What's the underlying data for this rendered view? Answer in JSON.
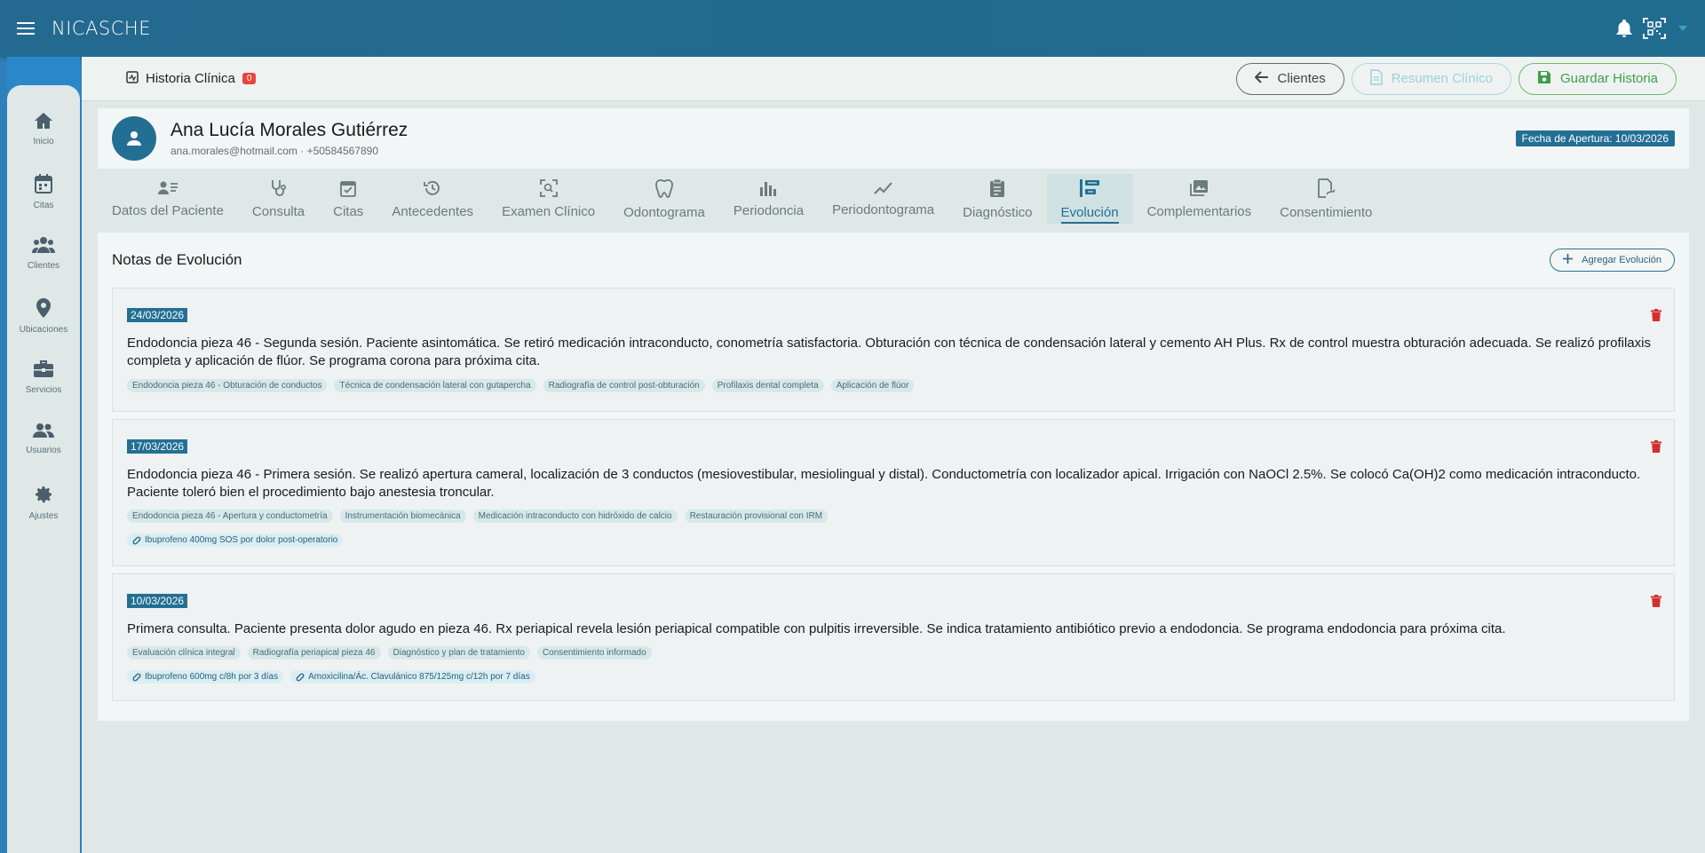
{
  "app": {
    "brand": "NICASCHE"
  },
  "sidebar": {
    "items": [
      {
        "label": "Inicio",
        "icon": "home-icon"
      },
      {
        "label": "Citas",
        "icon": "calendar-icon"
      },
      {
        "label": "Clientes",
        "icon": "people-icon"
      },
      {
        "label": "Ubicaciones",
        "icon": "location-icon"
      },
      {
        "label": "Servicios",
        "icon": "briefcase-icon"
      },
      {
        "label": "Usuarios",
        "icon": "users-icon"
      },
      {
        "label": "Ajustes",
        "icon": "gear-icon"
      }
    ]
  },
  "topbar": {
    "title": "Historia Clínica",
    "count": "0",
    "clientes_label": "Clientes",
    "resumen_label": "Resumen Clínico",
    "guardar_label": "Guardar Historia"
  },
  "patient": {
    "name": "Ana Lucía Morales Gutiérrez",
    "contact": "ana.morales@hotmail.com · +50584567890",
    "opening_date": "Fecha de Apertura: 10/03/2026"
  },
  "tabs": [
    {
      "label": "Datos del Paciente",
      "icon": "patient-list-icon"
    },
    {
      "label": "Consulta",
      "icon": "stethoscope-icon"
    },
    {
      "label": "Citas",
      "icon": "calendar-check-icon"
    },
    {
      "label": "Antecedentes",
      "icon": "history-icon"
    },
    {
      "label": "Examen Clínico",
      "icon": "scan-icon"
    },
    {
      "label": "Odontograma",
      "icon": "tooth-icon"
    },
    {
      "label": "Periodoncia",
      "icon": "bar-chart-icon"
    },
    {
      "label": "Periodontograma",
      "icon": "line-chart-icon"
    },
    {
      "label": "Diagnóstico",
      "icon": "clipboard-icon"
    },
    {
      "label": "Evolución",
      "icon": "timeline-icon",
      "active": true
    },
    {
      "label": "Complementarios",
      "icon": "images-icon"
    },
    {
      "label": "Consentimiento",
      "icon": "signature-icon"
    }
  ],
  "content": {
    "title": "Notas de Evolución",
    "add_label": "Agregar Evolución"
  },
  "notes": [
    {
      "date": "24/03/2026",
      "text": "Endodoncia pieza 46 - Segunda sesión. Paciente asintomática. Se retiró medicación intraconducto, conometría satisfactoria. Obturación con técnica de condensación lateral y cemento AH Plus. Rx de control muestra obturación adecuada. Se realizó profilaxis completa y aplicación de flúor. Se programa corona para próxima cita.",
      "tags": [
        "Endodoncia pieza 46 - Obturación de conductos",
        "Técnica de condensación lateral con gutapercha",
        "Radiografía de control post-obturación",
        "Profilaxis dental completa",
        "Aplicación de flúor"
      ],
      "meds": []
    },
    {
      "date": "17/03/2026",
      "text": "Endodoncia pieza 46 - Primera sesión. Se realizó apertura cameral, localización de 3 conductos (mesiovestibular, mesiolingual y distal). Conductometría con localizador apical. Irrigación con NaOCl 2.5%. Se colocó Ca(OH)2 como medicación intraconducto. Paciente toleró bien el procedimiento bajo anestesia troncular.",
      "tags": [
        "Endodoncia pieza 46 - Apertura y conductometría",
        "Instrumentación biomecánica",
        "Medicación intraconducto con hidróxido de calcio",
        "Restauración provisional con IRM"
      ],
      "meds": [
        "Ibuprofeno 400mg SOS por dolor post-operatorio"
      ]
    },
    {
      "date": "10/03/2026",
      "text": "Primera consulta. Paciente presenta dolor agudo en pieza 46. Rx periapical revela lesión periapical compatible con pulpitis irreversible. Se indica tratamiento antibiótico previo a endodoncia. Se programa endodoncia para próxima cita.",
      "tags": [
        "Evaluación clínica integral",
        "Radiografía periapical pieza 46",
        "Diagnóstico y plan de tratamiento",
        "Consentimiento informado"
      ],
      "meds": [
        "Ibuprofeno 600mg c/8h por 3 días",
        "Amoxicilina/Ác. Clavulánico 875/125mg c/12h por 7 días"
      ]
    }
  ]
}
